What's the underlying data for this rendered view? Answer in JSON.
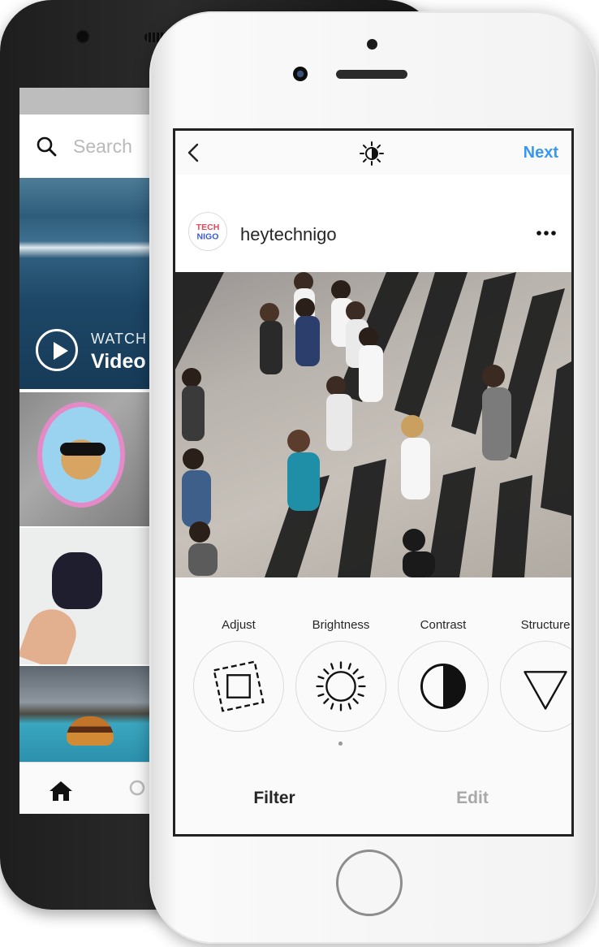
{
  "back_phone": {
    "search": {
      "placeholder": "Search"
    },
    "video_tile": {
      "watch_label": "WATCH",
      "title": "Video"
    }
  },
  "front_phone": {
    "topbar": {
      "next_label": "Next"
    },
    "post": {
      "username": "heytechnigo",
      "avatar_text": "TECH NIGO"
    },
    "tools": [
      {
        "label": "Adjust",
        "icon": "adjust-icon"
      },
      {
        "label": "Brightness",
        "icon": "brightness-icon"
      },
      {
        "label": "Contrast",
        "icon": "contrast-icon"
      },
      {
        "label": "Structure",
        "icon": "structure-icon"
      }
    ],
    "tabs": {
      "filter_label": "Filter",
      "edit_label": "Edit"
    }
  },
  "colors": {
    "accent": "#3897f0"
  }
}
